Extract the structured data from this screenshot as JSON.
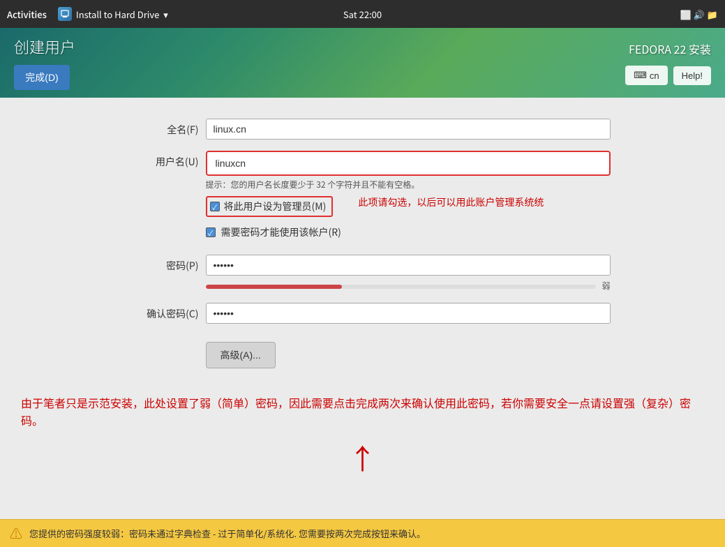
{
  "topbar": {
    "activities_label": "Activities",
    "install_label": "Install to Hard Drive",
    "dropdown_icon": "▾",
    "datetime": "Sat 22:00"
  },
  "header": {
    "page_title": "创建用户",
    "done_button": "完成(D)",
    "fedora_title": "FEDORA 22 安装",
    "lang_label": "cn",
    "help_label": "Help!"
  },
  "form": {
    "full_name_label": "全名(F)",
    "full_name_value": "linux.cn",
    "full_name_placeholder": "",
    "username_label": "用户名(U)",
    "username_value": "linuxcn",
    "hint_text": "提示：您的用户名长度要少于 32 个字符并且不能有空格。",
    "admin_checkbox_label": "将此用户设为管理员(M)",
    "require_password_label": "需要密码才能使用该帐户(R)",
    "password_label": "密码(P)",
    "password_value": "••••••",
    "strength_label": "弱",
    "confirm_password_label": "确认密码(C)",
    "confirm_password_value": "••••••",
    "advanced_button": "高级(A)...",
    "annotation_admin": "此项请勾选，以后可以用此账户管理系统统",
    "bottom_annotation": "由于笔者只是示范安装，此处设置了弱（简单）密码，因此需要点击完成两次来确认使用此密码，若你需要安全一点请设置强（复杂）密码。"
  },
  "statusbar": {
    "message": "您提供的密码强度较弱：密码未通过字典检查 - 过于简单化/系统化. 您需要按两次完成按钮来确认。"
  }
}
